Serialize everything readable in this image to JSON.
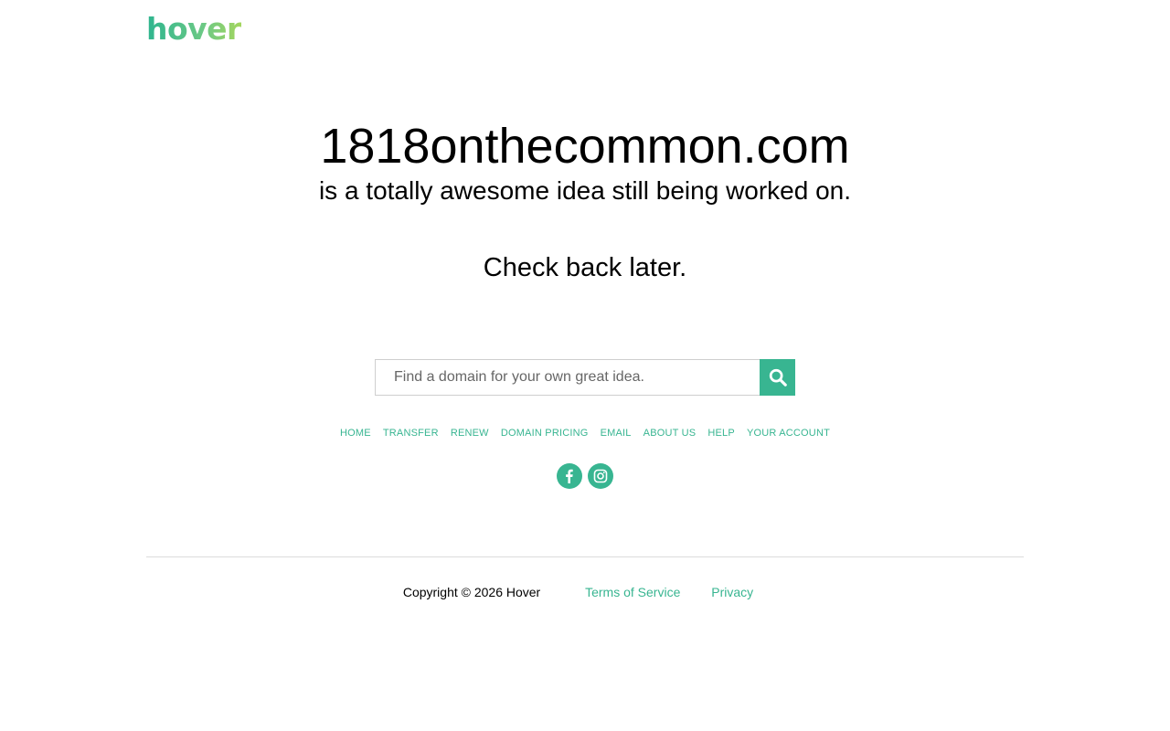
{
  "logo": {
    "text": "hover"
  },
  "hero": {
    "domain": "1818onthecommon.com",
    "subline": "is a totally awesome idea still being worked on.",
    "checkback": "Check back later."
  },
  "search": {
    "placeholder": "Find a domain for your own great idea.",
    "value": "",
    "button_icon": "search-icon"
  },
  "nav": {
    "items": [
      {
        "label": "HOME"
      },
      {
        "label": "TRANSFER"
      },
      {
        "label": "RENEW"
      },
      {
        "label": "DOMAIN PRICING"
      },
      {
        "label": "EMAIL"
      },
      {
        "label": "ABOUT US"
      },
      {
        "label": "HELP"
      },
      {
        "label": "YOUR ACCOUNT"
      }
    ]
  },
  "social": {
    "icons": [
      "facebook-icon",
      "instagram-icon"
    ]
  },
  "footer": {
    "copyright": "Copyright © 2026 Hover",
    "terms": "Terms of Service",
    "privacy": "Privacy"
  },
  "colors": {
    "accent": "#38b591",
    "logo_gradient_start": "#2eb58f",
    "logo_gradient_end": "#a4d65e",
    "text": "#000000",
    "divider": "#dcdcdc"
  }
}
